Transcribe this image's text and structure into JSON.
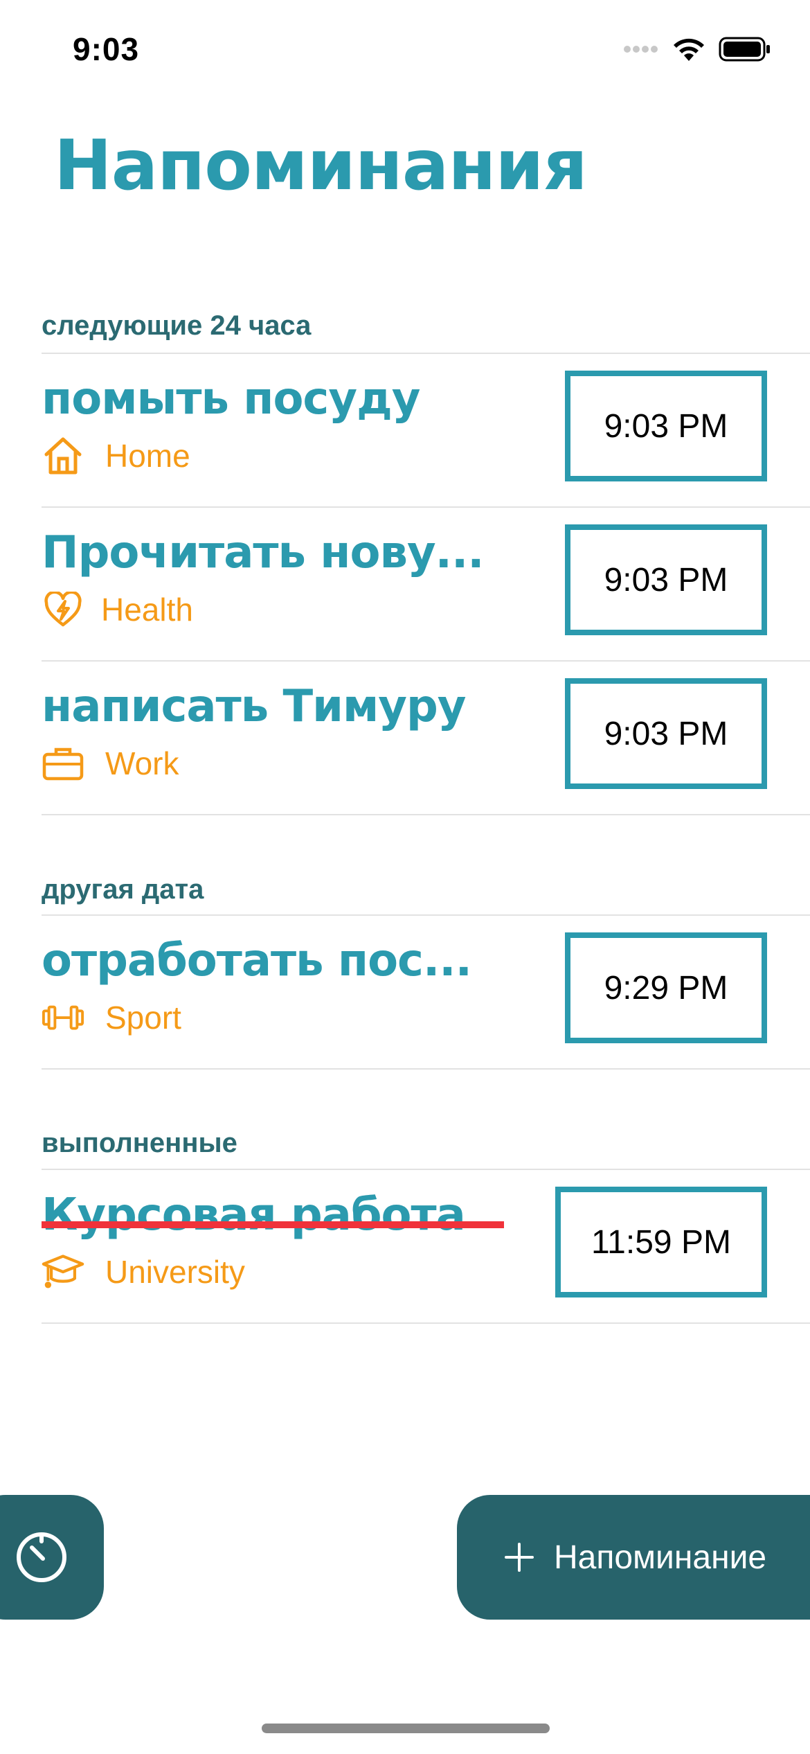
{
  "status_bar": {
    "time": "9:03"
  },
  "page_title": "Напоминания",
  "sections": [
    {
      "header": "следующие 24 часа",
      "items": [
        {
          "title": "помыть посуду",
          "category": "Home",
          "category_icon": "house-icon",
          "time": "9:03 PM",
          "completed": false
        },
        {
          "title": "Прочитать нову...",
          "category": "Health",
          "category_icon": "heart-bolt-icon",
          "time": "9:03 PM",
          "completed": false
        },
        {
          "title": "написать Тимуру",
          "category": "Work",
          "category_icon": "briefcase-icon",
          "time": "9:03 PM",
          "completed": false
        }
      ]
    },
    {
      "header": "другая дата",
      "items": [
        {
          "title": "отработать пос...",
          "category": "Sport",
          "category_icon": "dumbbell-icon",
          "time": "9:29 PM",
          "completed": false
        }
      ]
    },
    {
      "header": "выполненные",
      "items": [
        {
          "title": "Курсовая работа",
          "category": "University",
          "category_icon": "graduation-cap-icon",
          "time": "11:59 PM",
          "completed": true
        }
      ]
    }
  ],
  "buttons": {
    "timer_icon": "timer-icon",
    "add_icon": "plus-icon",
    "add_label": "Напоминание"
  },
  "colors": {
    "accent": "#2b9aae",
    "category": "#f59a17",
    "button_bg": "#27636b",
    "section_header": "#2b6a72",
    "strike": "#f0323a"
  }
}
